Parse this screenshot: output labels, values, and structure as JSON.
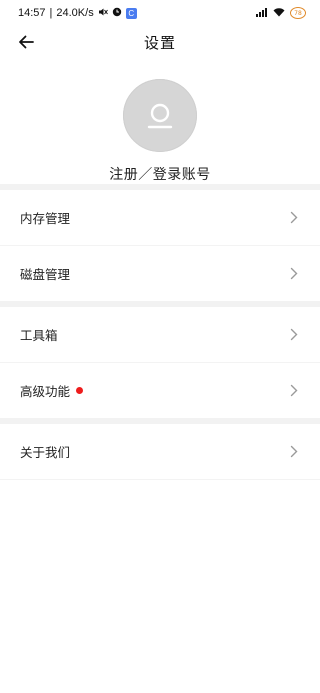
{
  "status": {
    "time": "14:57",
    "speed": "24.0K/s",
    "battery": "78"
  },
  "header": {
    "title": "设置"
  },
  "profile": {
    "login_text": "注册／登录账号"
  },
  "groups": [
    {
      "items": [
        {
          "label": "内存管理"
        },
        {
          "label": "磁盘管理"
        }
      ]
    },
    {
      "items": [
        {
          "label": "工具箱"
        },
        {
          "label": "高级功能",
          "badge": true
        }
      ]
    },
    {
      "items": [
        {
          "label": "关于我们"
        }
      ]
    }
  ],
  "colors": {
    "badge": "#ee1c1c",
    "divider": "#f2f2f2"
  }
}
